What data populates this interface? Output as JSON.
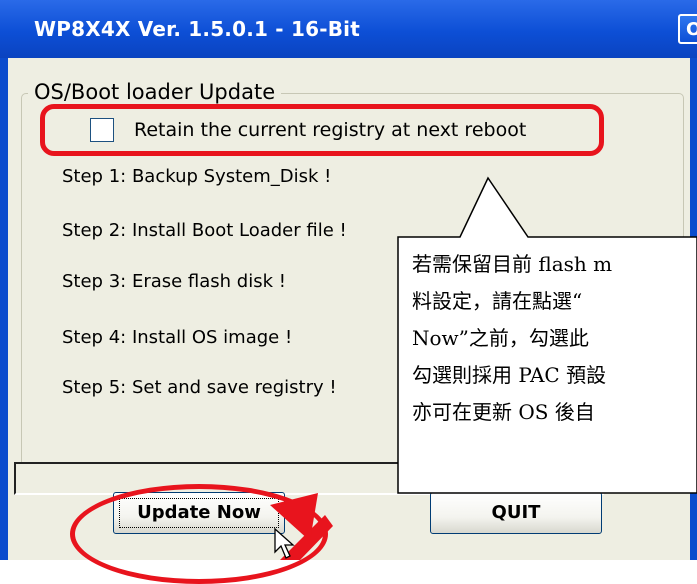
{
  "window": {
    "title": "WP8X4X Ver. 1.5.0.1 - 16-Bit",
    "ok_label": "OK"
  },
  "group": {
    "title": "OS/Boot loader Update",
    "retain_registry": {
      "label": "Retain the current registry at next reboot",
      "checked": false
    }
  },
  "steps": [
    "Step 1: Backup System_Disk !",
    "Step 2: Install Boot Loader file !",
    "Step 3: Erase flash disk !",
    "Step 4: Install OS image !",
    "Step 5: Set and save registry !"
  ],
  "progress": {
    "value": 0
  },
  "buttons": {
    "update_label": "Update Now",
    "quit_label": "QUIT"
  },
  "callout": {
    "lines": [
      "若需保留目前 flash m",
      "料設定，請在點選“",
      "Now”之前，勾選此",
      "勾選則採用 PAC 預設",
      "亦可在更新 OS 後自"
    ]
  },
  "colors": {
    "titlebar": "#0d4fd6",
    "annotation": "#e8141d",
    "dialog_bg": "#eeeee2"
  }
}
